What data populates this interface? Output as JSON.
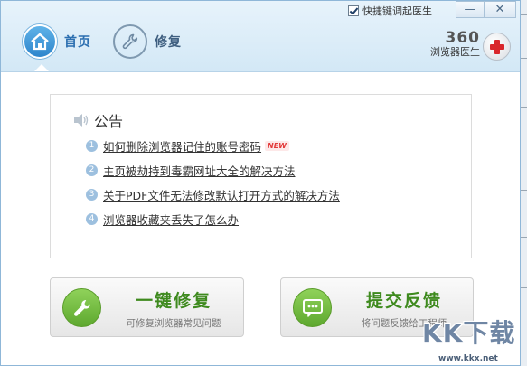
{
  "header": {
    "tabs": [
      {
        "label": "首页",
        "icon": "home-icon",
        "active": true
      },
      {
        "label": "修复",
        "icon": "wrench-icon",
        "active": false
      }
    ],
    "shortcut_label": "快捷键调起医生",
    "shortcut_checked": true,
    "window_buttons": {
      "minimize": "—",
      "close": "✕"
    },
    "brand": {
      "number": "360",
      "name": "浏览器医生"
    }
  },
  "notice": {
    "title": "公告",
    "items": [
      {
        "num": "1",
        "text": "如何删除浏览器记住的账号密码",
        "badge": "NEW"
      },
      {
        "num": "2",
        "text": "主页被劫持到毒霸网址大全的解决方法"
      },
      {
        "num": "3",
        "text": "关于PDF文件无法修改默认打开方式的解决方法"
      },
      {
        "num": "4",
        "text": "浏览器收藏夹丢失了怎么办"
      }
    ]
  },
  "actions": {
    "repair": {
      "title": "一键修复",
      "subtitle": "可修复浏览器常见问题",
      "icon": "wrench-icon"
    },
    "feedback": {
      "title": "提交反馈",
      "subtitle": "将问题反馈给工程师",
      "icon": "chat-bubble-icon"
    }
  },
  "watermark": {
    "logo": "KK下载",
    "url": "www.kkx.net"
  },
  "colors": {
    "accent_blue": "#2f86cc",
    "accent_green": "#5ea82f",
    "badge_red": "#e23b3b"
  }
}
